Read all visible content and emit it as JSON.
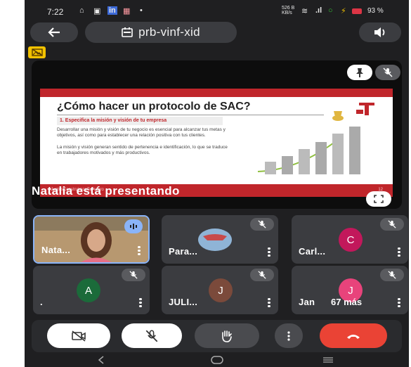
{
  "status_bar": {
    "time": "7:22",
    "network_speed": "526 B KB/s",
    "battery": "93 %"
  },
  "header": {
    "meeting_code": "prb-vinf-xid"
  },
  "presentation": {
    "presenter_caption": "Natalia está presentando",
    "slide": {
      "title": "¿Cómo hacer un protocolo de SAC?",
      "subtitle": "1. Especifica la misión y visión de tu empresa",
      "paragraph_1": "Desarrollar una misión y visión de tu negocio es esencial para alcanzar tus metas y objetivos, así como para establecer una relación positiva con tus clientes.",
      "paragraph_2": "La misión y visión generan sentido de pertenencia e identificación, lo que se traduce en trabajadores motivados y más productivos.",
      "footer_hashtag": "#JuntosConstruimosTuFuturo",
      "footer_page": "12"
    }
  },
  "participants": [
    {
      "name": "Nata...",
      "type": "video",
      "speaking": true
    },
    {
      "name": "Para...",
      "type": "photo",
      "muted": true
    },
    {
      "name": "Carl...",
      "type": "initial",
      "initial": "C",
      "color": "#c2185b",
      "muted": true
    },
    {
      "name": ".",
      "type": "initial",
      "initial": "A",
      "color": "#1b6b3a",
      "muted": true
    },
    {
      "name": "JULI...",
      "type": "initial",
      "initial": "J",
      "color": "#7b4a3b",
      "muted": true
    },
    {
      "name": "Jan",
      "type": "initial",
      "initial": "J",
      "color": "#e8437b",
      "muted": true,
      "overflow_label": "67 más"
    }
  ],
  "controls": {
    "camera": "camera-off",
    "mic": "mic-off",
    "raise_hand": "hand",
    "more": "more-vert",
    "leave": "hang-up",
    "leave_color": "#ea4335"
  },
  "colors": {
    "background": "#1f1f21",
    "tile": "#3b3c40",
    "accent_badge": "#f2c200"
  }
}
